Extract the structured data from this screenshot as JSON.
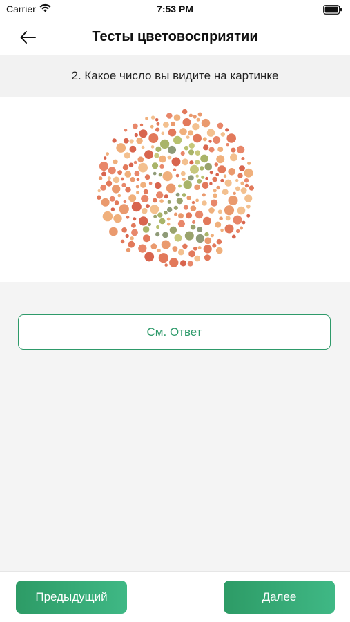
{
  "status_bar": {
    "carrier": "Carrier",
    "time": "7:53 PM"
  },
  "nav": {
    "title": "Тесты цветовосприятии"
  },
  "question": {
    "text": "2. Какое число вы видите на картинке"
  },
  "answer": {
    "button_label": "См. Ответ"
  },
  "footer": {
    "prev_label": "Предыдущий",
    "next_label": "Далее"
  },
  "colors": {
    "accent": "#2e9a6a",
    "plate_background_dots": [
      "#e2795b",
      "#ea9a6e",
      "#f0b07c",
      "#d8654e",
      "#f3c08f",
      "#e8876a"
    ],
    "plate_figure_dots": [
      "#9aa36d",
      "#b8c16e",
      "#8f9b78",
      "#c7c77c",
      "#a9b469"
    ]
  }
}
